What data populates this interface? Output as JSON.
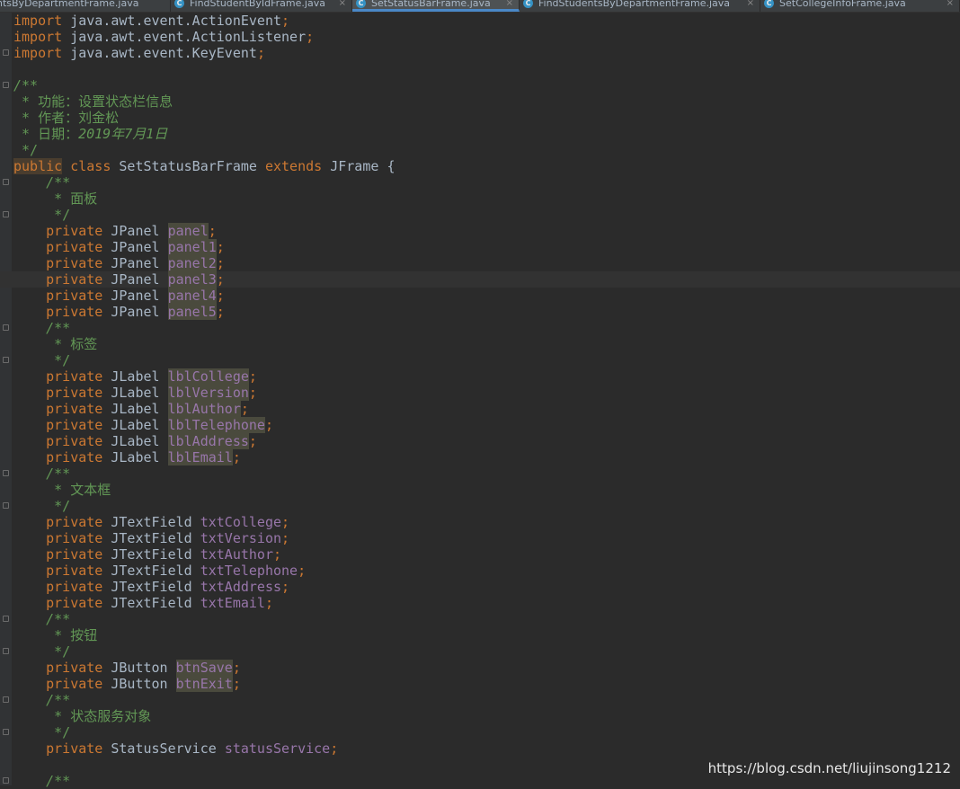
{
  "tabs": [
    {
      "label": "ntsByDepartmentFrame.java",
      "has_icon": false,
      "active": false
    },
    {
      "label": "FindStudentByIdFrame.java",
      "has_icon": true,
      "active": false
    },
    {
      "label": "SetStatusBarFrame.java",
      "has_icon": true,
      "active": true
    },
    {
      "label": "FindStudentsByDepartmentFrame.java",
      "has_icon": true,
      "active": false
    },
    {
      "label": "SetCollegeInfoFrame.java",
      "has_icon": true,
      "active": false
    }
  ],
  "tab_icon_letter": "C",
  "tab_close_glyph": "×",
  "colors": {
    "background": "#2b2b2b",
    "keyword": "#cc7832",
    "field": "#9876aa",
    "comment": "#629755",
    "text": "#a9b7c6",
    "active_tab_underline": "#4a88c7"
  },
  "code": {
    "imports": [
      {
        "keyword": "import",
        "path": "java.awt.event.ActionEvent"
      },
      {
        "keyword": "import",
        "path": "java.awt.event.ActionListener"
      },
      {
        "keyword": "import",
        "path": "java.awt.event.KeyEvent"
      }
    ],
    "header_comment": {
      "open": "/**",
      "lines": [
        " * 功能：设置状态栏信息",
        " * 作者：刘金松"
      ],
      "date_prefix": " * 日期：",
      "date": "2019年7月1日",
      "close": " */"
    },
    "class_decl": {
      "public_kw": "public",
      "class_kw": "class",
      "name": "SetStatusBarFrame",
      "extends_kw": "extends",
      "parent": "JFrame",
      "brace": "{"
    },
    "sections": [
      {
        "comment": "面板",
        "type": "JPanel",
        "highlighted": true,
        "fields": [
          "panel",
          "panel1",
          "panel2",
          "panel3",
          "panel4",
          "panel5"
        ]
      },
      {
        "comment": "标签",
        "type": "JLabel",
        "highlighted": true,
        "fields": [
          "lblCollege",
          "lblVersion",
          "lblAuthor",
          "lblTelephone",
          "lblAddress",
          "lblEmail"
        ]
      },
      {
        "comment": "文本框",
        "type": "JTextField",
        "highlighted": false,
        "fields": [
          "txtCollege",
          "txtVersion",
          "txtAuthor",
          "txtTelephone",
          "txtAddress",
          "txtEmail"
        ]
      },
      {
        "comment": "按钮",
        "type": "JButton",
        "highlighted": true,
        "fields": [
          "btnSave",
          "btnExit"
        ]
      },
      {
        "comment": "状态服务对象",
        "type": "StatusService",
        "highlighted": false,
        "fields": [
          "statusService"
        ]
      }
    ],
    "private_kw": "private",
    "doc_open": "/**",
    "doc_star": " * ",
    "doc_close": " */",
    "trailing_doc_open": "/**"
  },
  "watermark": "https://blog.csdn.net/liujinsong1212"
}
